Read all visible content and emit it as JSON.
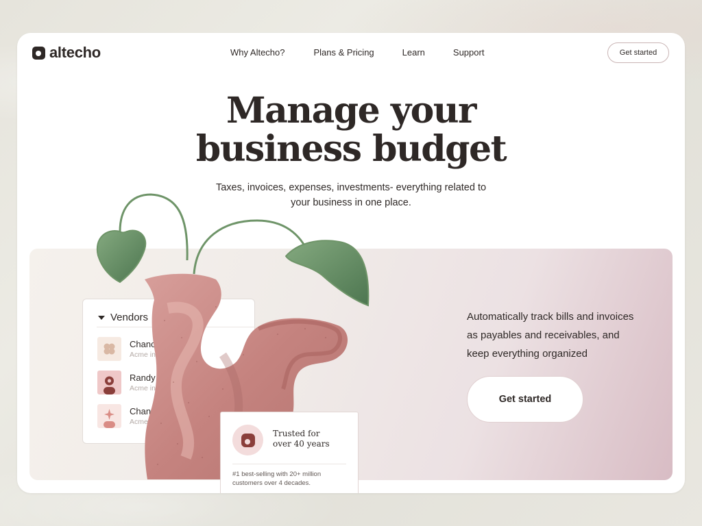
{
  "brand": {
    "name": "altecho"
  },
  "nav": {
    "items": [
      {
        "label": "Why Altecho?"
      },
      {
        "label": "Plans & Pricing"
      },
      {
        "label": "Learn"
      },
      {
        "label": "Support"
      }
    ],
    "cta_label": "Get started"
  },
  "hero": {
    "headline_line1": "Manage your",
    "headline_line2": "business budget",
    "subhead_line1": "Taxes, invoices, expenses, investments- everything related to",
    "subhead_line2": "your business in one place."
  },
  "vendors": {
    "title": "Vendors",
    "items": [
      {
        "name": "Chance Levin",
        "company": "Acme inc",
        "icon": "flower-icon"
      },
      {
        "name": "Randy Stanton",
        "company": "Acme inc",
        "icon": "person-icon"
      },
      {
        "name": "Chance C",
        "company": "Acme inc",
        "icon": "sparkle-icon"
      }
    ]
  },
  "trust": {
    "title_line1": "Trusted for",
    "title_line2": "over 40 years",
    "text_line1": "#1 best-selling with 20+ million",
    "text_line2": "customers over 4 decades."
  },
  "feature": {
    "line1": "Automatically track bills and invoices",
    "line2": "as payables and receivables, and",
    "line3": "keep everything organized",
    "cta_label": "Get started"
  },
  "colors": {
    "text": "#2e2826",
    "leaf": "#5f8a5e",
    "vase": "#c98e8c",
    "accent_pink": "#f3dcdc",
    "brand_mark": "#8a3e3a"
  }
}
